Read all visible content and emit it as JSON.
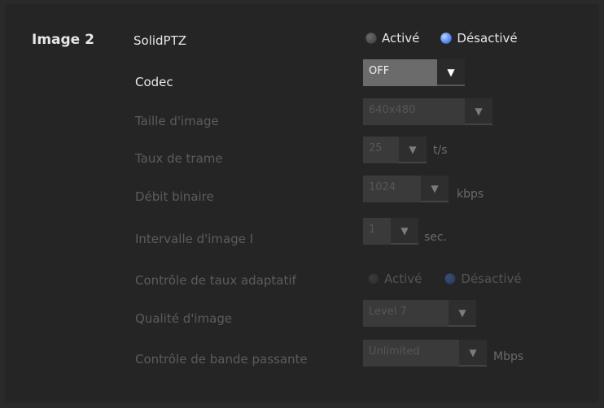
{
  "section": {
    "title": "Image 2"
  },
  "solidptz": {
    "label": "SolidPTZ",
    "options": [
      "Activé",
      "Désactivé"
    ],
    "selected": "Désactivé"
  },
  "codec": {
    "label": "Codec",
    "value": "OFF"
  },
  "image_size": {
    "label": "Taille d'image",
    "value": "640x480"
  },
  "frame_rate": {
    "label": "Taux de trame",
    "value": "25",
    "unit": "t/s"
  },
  "bitrate": {
    "label": "Débit binaire",
    "value": "1024",
    "unit": "kbps"
  },
  "i_frame_interval": {
    "label": "Intervalle d'image I",
    "value": "1",
    "unit": "sec."
  },
  "adaptive_rate": {
    "label": "Contrôle de taux adaptatif",
    "options": [
      "Activé",
      "Désactivé"
    ],
    "selected": "Désactivé"
  },
  "image_quality": {
    "label": "Qualité d'image",
    "value": "Level 7"
  },
  "bandwidth": {
    "label": "Contrôle de bande passante",
    "value": "Unlimited",
    "unit": "Mbps"
  },
  "icons": {
    "dropdown": "triangle-down-icon",
    "radio": "radio-button"
  },
  "colors": {
    "accent": "#5a8cf0",
    "background": "#252525",
    "disabled_text": "#5c5c5c"
  }
}
